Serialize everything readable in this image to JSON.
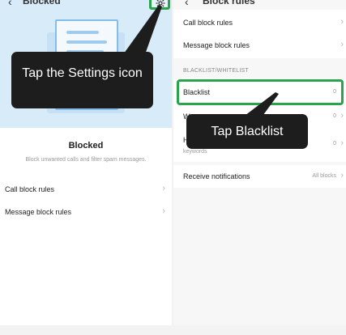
{
  "left": {
    "title": "Blocked",
    "app_name": "Blocked",
    "app_description": "Block unwanted calls and filter spam messages.",
    "rows": [
      {
        "label": "Call block rules"
      },
      {
        "label": "Message block rules"
      }
    ],
    "callout": "Tap the Settings icon"
  },
  "right": {
    "title": "Block rules",
    "rows_top": [
      {
        "label": "Call block rules"
      },
      {
        "label": "Message block rules"
      }
    ],
    "section_header": "BLACKLIST/WHITELIST",
    "blacklist": {
      "label": "Blacklist",
      "value": "0"
    },
    "whitelist": {
      "label": "W",
      "value": "0"
    },
    "keywords": {
      "label": "H",
      "sub": "keywords",
      "value": "0"
    },
    "notifications": {
      "label": "Receive notifications",
      "value": "All blocks"
    },
    "callout": "Tap Blacklist"
  },
  "colors": {
    "highlight": "#2aa44a",
    "callout_bg": "#1d1d1d",
    "hero_bg": "#d8ebf8"
  }
}
